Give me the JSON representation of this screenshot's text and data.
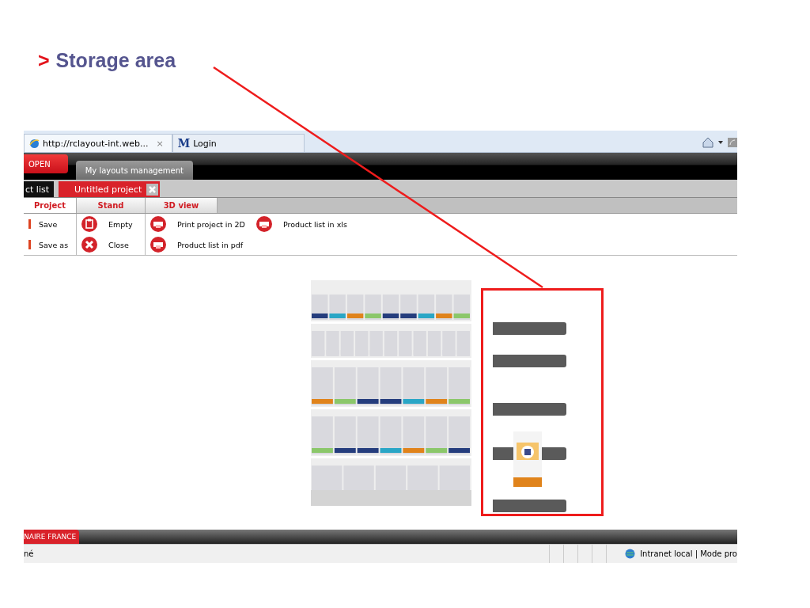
{
  "heading": {
    "marker": ">",
    "text": "Storage area"
  },
  "browser_tabs": [
    {
      "label": "http://rclayout-int.web...",
      "close": "×",
      "selected": true,
      "kind": "ie"
    },
    {
      "label": "Login",
      "logo": "M",
      "selected": false,
      "kind": "m"
    }
  ],
  "app_nav": [
    {
      "label": "OPEN",
      "selected": true
    },
    {
      "label": "My layouts management",
      "selected": false
    }
  ],
  "project_tabs": [
    {
      "label": "ct list",
      "selected": false,
      "closable": false
    },
    {
      "label": "Untitled project",
      "selected": true,
      "closable": true
    }
  ],
  "ribbon_tabs": [
    {
      "label": "Project",
      "selected": true
    },
    {
      "label": "Stand",
      "selected": false
    },
    {
      "label": "3D view",
      "selected": false
    }
  ],
  "ribbon_groups": [
    {
      "items": [
        {
          "label": "Save",
          "kind": "cut"
        },
        {
          "label": "Save as",
          "kind": "cut"
        }
      ]
    },
    {
      "items": [
        {
          "label": "Empty",
          "kind": "clip"
        },
        {
          "label": "Close",
          "kind": "close"
        }
      ]
    },
    {
      "items": [
        {
          "label": "Print project in 2D",
          "kind": "print"
        },
        {
          "label": "Product list in pdf",
          "kind": "print"
        },
        {
          "label": "Product list in xls",
          "kind": "print"
        }
      ]
    }
  ],
  "footer": {
    "brand": "NAIRE FRANCE"
  },
  "status_bar": {
    "left": "né",
    "zone": "Intranet local | Mode pro"
  }
}
